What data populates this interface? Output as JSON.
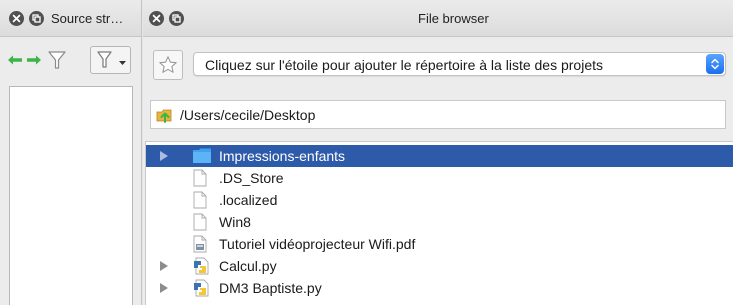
{
  "left_panel": {
    "title": "Source str…"
  },
  "file_browser": {
    "title": "File browser",
    "project_select": {
      "text": "Cliquez sur l'étoile pour ajouter le répertoire à la liste des projets"
    },
    "path": "/Users/cecile/Desktop",
    "files": [
      {
        "name": "Impressions-enfants",
        "type": "folder",
        "expandable": true,
        "selected": true
      },
      {
        "name": ".DS_Store",
        "type": "file",
        "expandable": false,
        "selected": false
      },
      {
        "name": ".localized",
        "type": "file",
        "expandable": false,
        "selected": false
      },
      {
        "name": "Win8",
        "type": "file",
        "expandable": false,
        "selected": false
      },
      {
        "name": "Tutoriel vidéoprojecteur Wifi.pdf",
        "type": "pdf",
        "expandable": false,
        "selected": false
      },
      {
        "name": "Calcul.py",
        "type": "python",
        "expandable": true,
        "selected": false
      },
      {
        "name": "DM3 Baptiste.py",
        "type": "python",
        "expandable": true,
        "selected": false
      }
    ]
  },
  "colors": {
    "selection": "#2d5aa9",
    "folder": "#3fa2f0",
    "nav_arrow": "#3bb54a",
    "select_arrow": "#1a6ff0"
  },
  "icons": {
    "close": "close-icon",
    "float": "float-icon",
    "back": "arrow-left-icon",
    "forward": "arrow-right-icon",
    "filter": "funnel-icon",
    "star": "star-icon",
    "folder": "folder-icon",
    "file": "file-icon",
    "pdf": "pdf-file-icon",
    "python": "python-file-icon"
  }
}
